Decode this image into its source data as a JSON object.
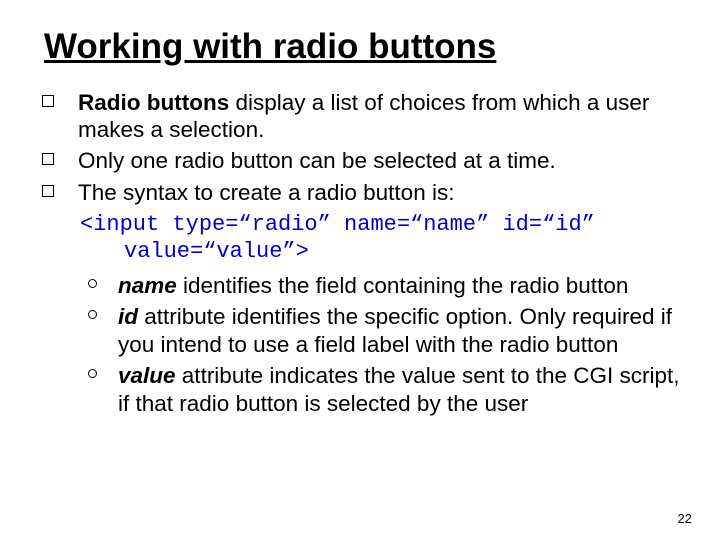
{
  "title": "Working with radio buttons",
  "bullets": {
    "b1_pre": "Radio buttons",
    "b1_post": " display a list of choices from which a user makes a selection.",
    "b2": "Only one radio button can be selected at a time.",
    "b3": "The syntax to create a radio button is:"
  },
  "code": {
    "line1": "<input type=“radio” name=“name” id=“id”",
    "line2": "value=“value”>"
  },
  "sub": {
    "s1_b": "name",
    "s1_t": " identifies the field containing the radio button",
    "s2_b": "id",
    "s2_t": " attribute identifies the specific option.  Only required if you intend to use a field label with the radio button",
    "s3_b": "value",
    "s3_t": " attribute indicates the value sent to the CGI script, if that radio button is selected by the user"
  },
  "page_number": "22"
}
